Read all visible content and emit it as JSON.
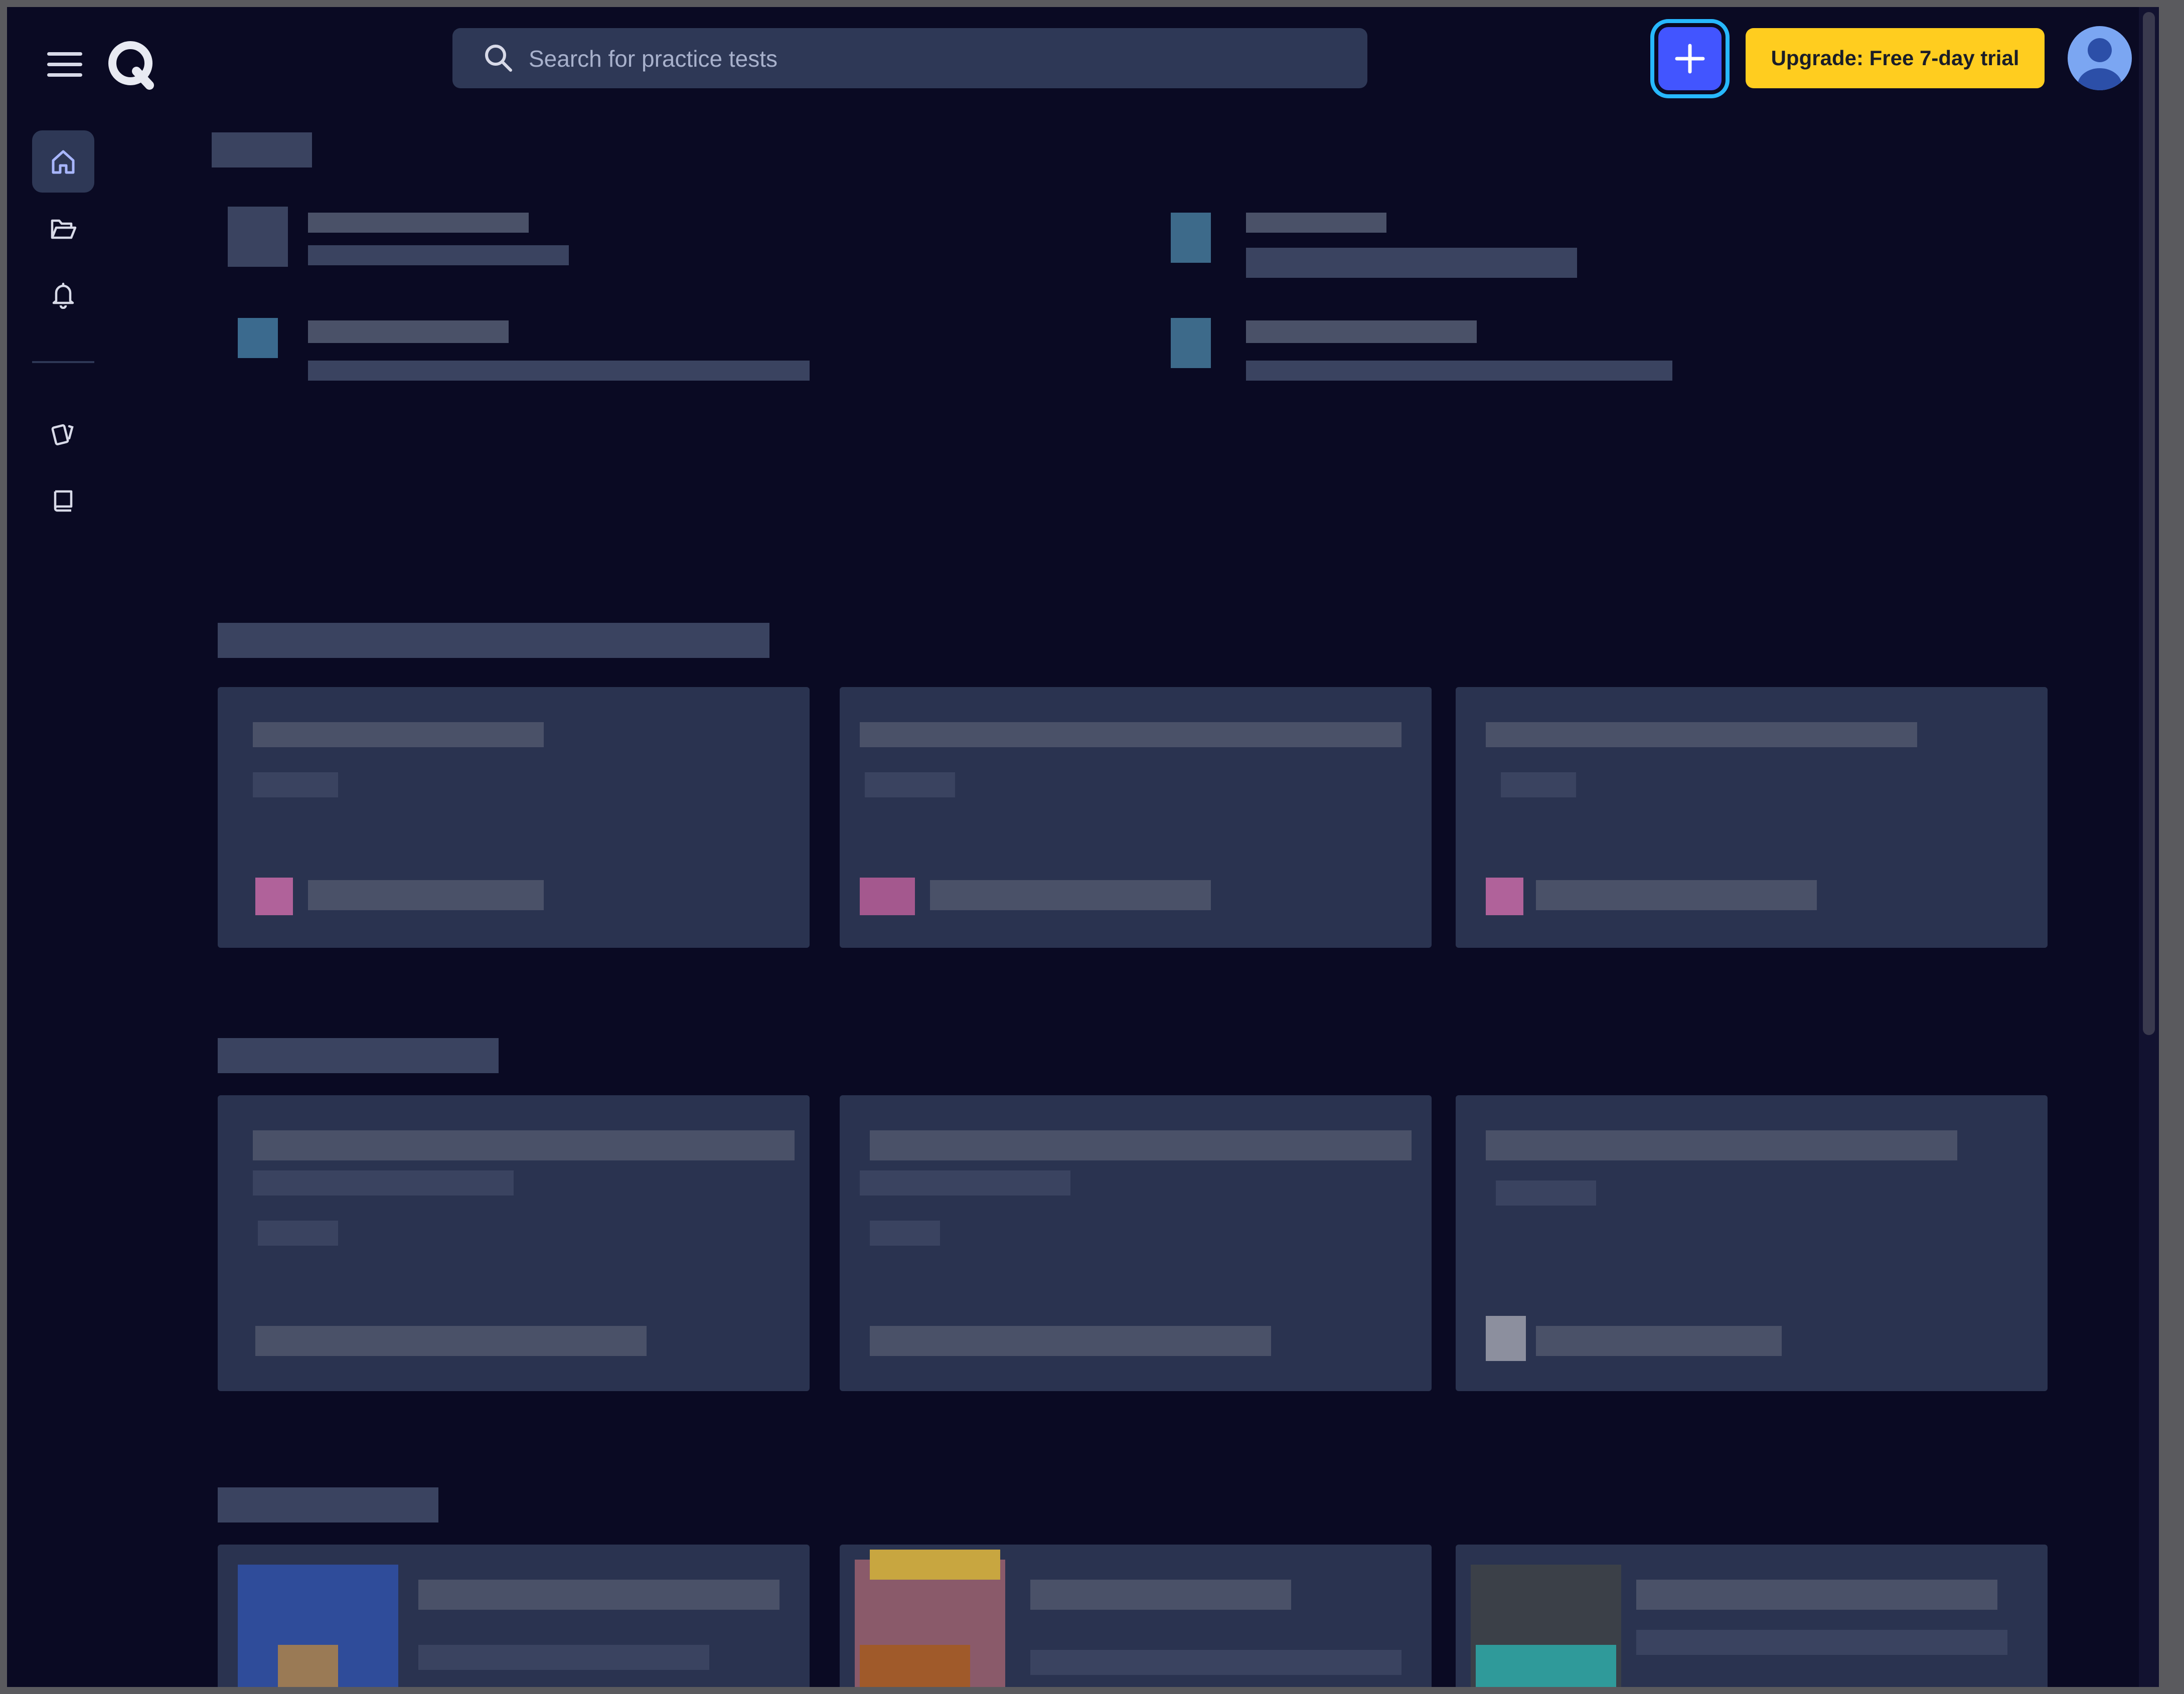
{
  "header": {
    "search_placeholder": "Search for practice tests",
    "upgrade_label": "Upgrade: Free 7-day trial"
  },
  "sidebar": {
    "items": [
      {
        "icon": "home-icon",
        "active": true
      },
      {
        "icon": "folder-icon",
        "active": false
      },
      {
        "icon": "bell-icon",
        "active": false
      },
      {
        "icon": "flashcards-icon",
        "active": false
      },
      {
        "icon": "book-icon",
        "active": false
      }
    ]
  },
  "colors": {
    "background": "#0a0a23",
    "surface": "#2e3856",
    "accent": "#4255ff",
    "upgrade": "#ffcd1f"
  }
}
